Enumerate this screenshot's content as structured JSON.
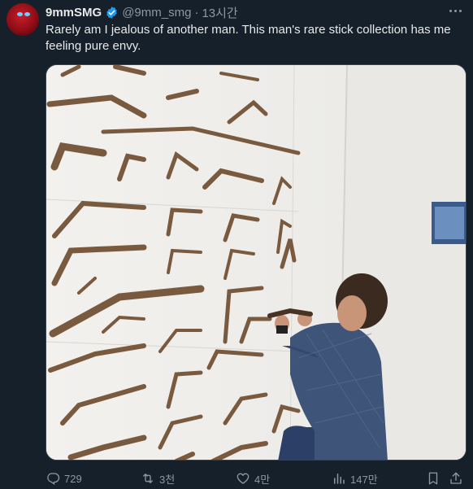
{
  "author": {
    "display_name": "9mmSMG",
    "handle": "@9mm_smg",
    "separator": "·",
    "time": "13시간"
  },
  "tweet": {
    "text": "Rarely am I jealous of another man. This man's rare stick collection has me feeling pure envy."
  },
  "actions": {
    "replies": "729",
    "retweets": "3천",
    "likes": "4만",
    "views": "147만"
  },
  "icons": {
    "verified": "verified-badge-icon",
    "more": "more-dots-icon",
    "reply": "reply-icon",
    "retweet": "retweet-icon",
    "like": "heart-icon",
    "views": "views-chart-icon",
    "bookmark": "bookmark-icon",
    "share": "share-icon"
  },
  "colors": {
    "background": "#15202b",
    "text": "#e7e9ea",
    "muted": "#8b98a5",
    "verified": "#1d9bf0"
  }
}
